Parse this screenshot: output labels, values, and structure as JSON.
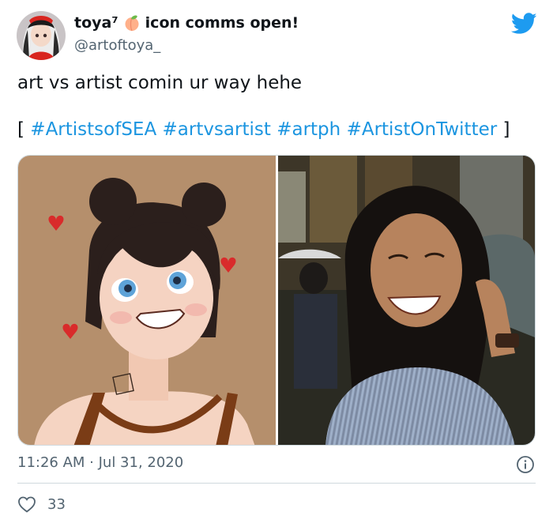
{
  "tweet": {
    "display_name": "toya⁷",
    "name_suffix": "icon comms open!",
    "handle": "@artoftoya_",
    "text": "art vs artist comin ur way hehe",
    "tag_open": "[",
    "hashtags": [
      "#ArtistsofSEA",
      "#artvsartist",
      "#artph",
      "#ArtistOnTwitter"
    ],
    "tag_close": "]",
    "timestamp": "11:26 AM · Jul 31, 2020",
    "like_count": "33"
  },
  "icons": {
    "logo": "twitter-bird-icon",
    "emoji": "peach-icon",
    "info": "info-icon",
    "like": "heart-icon"
  },
  "colors": {
    "brand": "#1d9bf0",
    "hashtag": "#1b95e0",
    "secondary_text": "#536471",
    "primary_text": "#0f1419",
    "divider": "#cfd9de"
  }
}
